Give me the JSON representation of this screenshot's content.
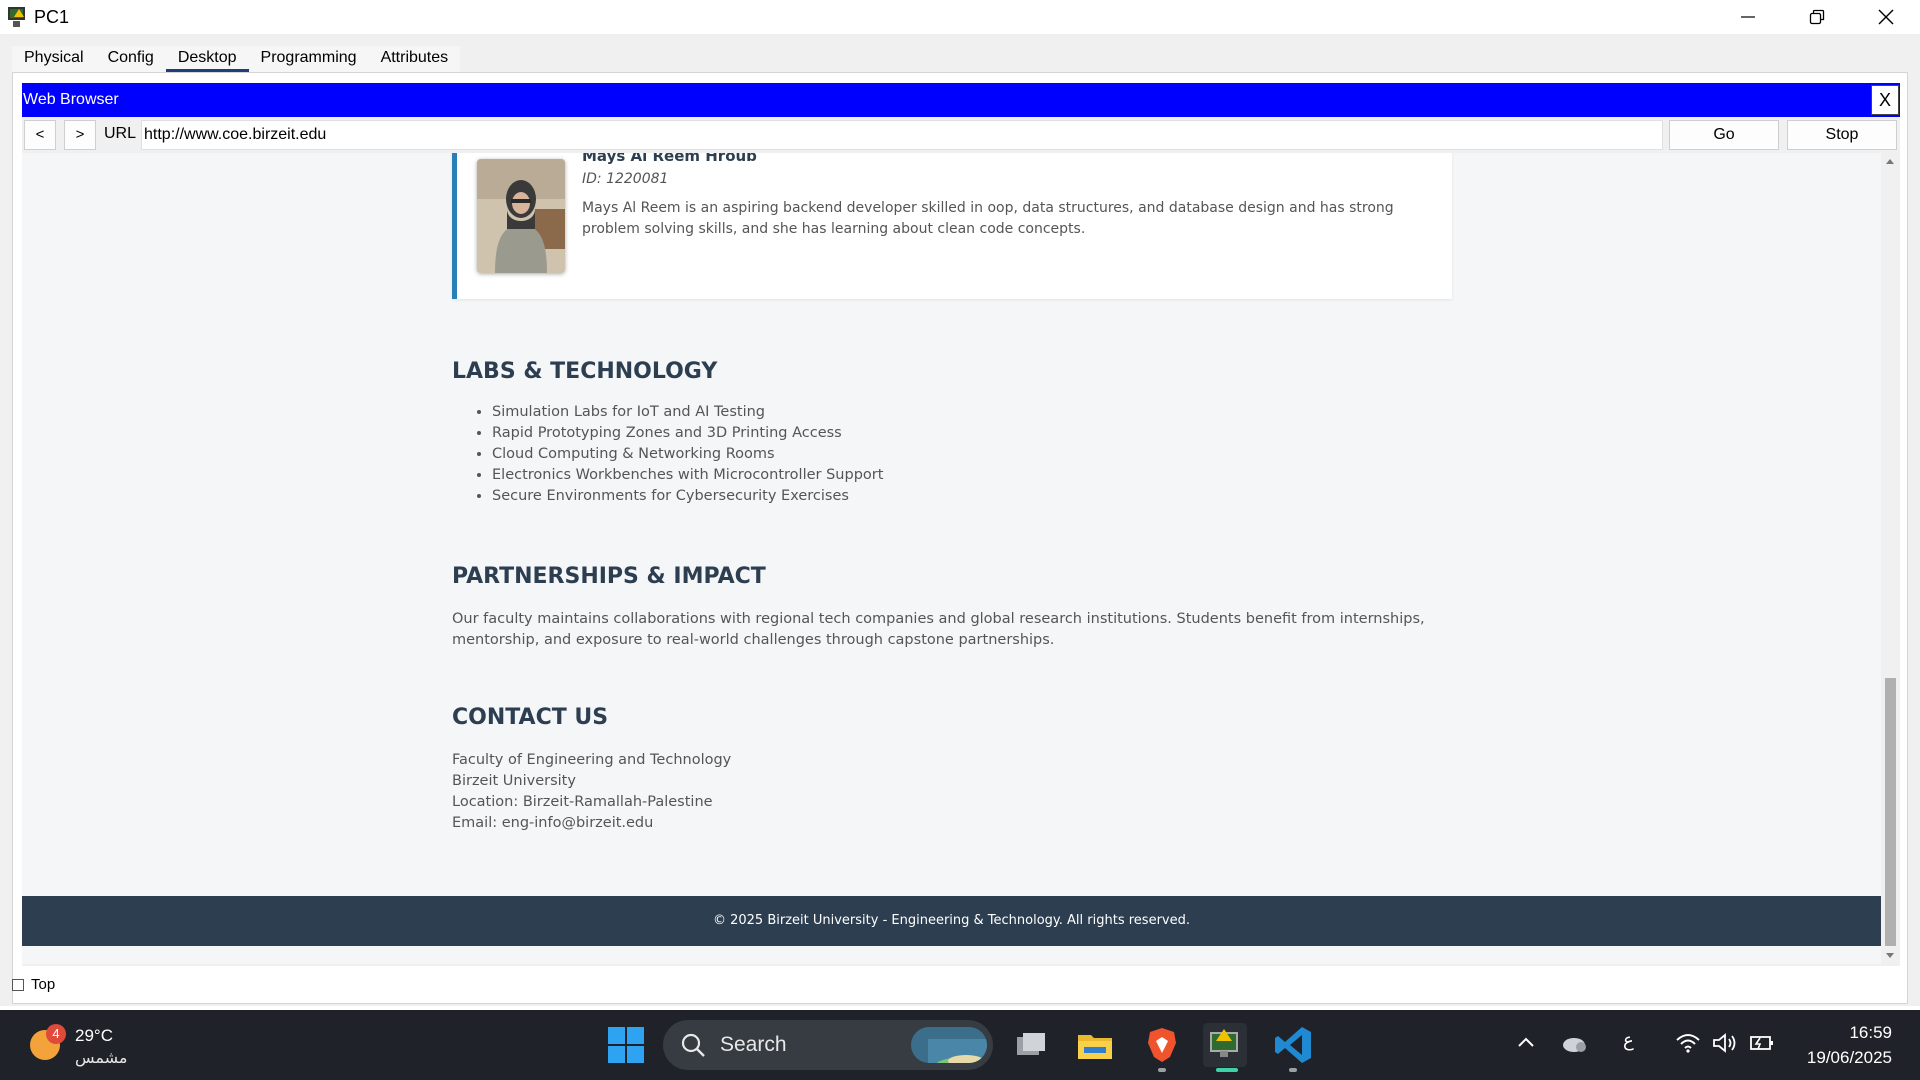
{
  "window": {
    "title": "PC1"
  },
  "tabs": [
    {
      "label": "Physical"
    },
    {
      "label": "Config"
    },
    {
      "label": "Desktop"
    },
    {
      "label": "Programming"
    },
    {
      "label": "Attributes"
    }
  ],
  "active_tab": "Desktop",
  "browser": {
    "title": "Web Browser",
    "close_label": "X",
    "back_label": "<",
    "forward_label": ">",
    "url_label": "URL",
    "url_value": "http://www.coe.birzeit.edu",
    "go_label": "Go",
    "stop_label": "Stop"
  },
  "page": {
    "member": {
      "name": "Mays Al Reem Hroub",
      "id": "ID: 1220081",
      "description": "Mays Al Reem is an aspiring backend developer skilled in oop, data structures, and database design and has strong problem solving skills, and she has learning about clean code concepts."
    },
    "labs": {
      "title": "LABS & TECHNOLOGY",
      "items": [
        "Simulation Labs for IoT and AI Testing",
        "Rapid Prototyping Zones and 3D Printing Access",
        "Cloud Computing & Networking Rooms",
        "Electronics Workbenches with Microcontroller Support",
        "Secure Environments for Cybersecurity Exercises"
      ]
    },
    "partnerships": {
      "title": "PARTNERSHIPS & IMPACT",
      "text": "Our faculty maintains collaborations with regional tech companies and global research institutions. Students benefit from internships, mentorship, and exposure to real-world challenges through capstone partnerships."
    },
    "contact": {
      "title": "CONTACT US",
      "lines": [
        "Faculty of Engineering and Technology",
        "Birzeit University",
        "Location: Birzeit-Ramallah-Palestine",
        "Email: eng-info@birzeit.edu"
      ]
    },
    "footer": "© 2025 Birzeit University - Engineering & Technology. All rights reserved."
  },
  "top_checkbox": {
    "label": "Top",
    "checked": false
  },
  "taskbar": {
    "weather": {
      "badge": "4",
      "temperature": "29°C",
      "condition": "مشمس"
    },
    "search_label": "Search",
    "language": "ع",
    "time": "16:59",
    "date": "19/06/2025"
  },
  "colors": {
    "browser_title_bar": "#0000ff",
    "card_accent": "#2980b9",
    "heading_text": "#2c3e50",
    "footer_bg": "#2c3e50",
    "active_tab_underline": "#1f3f7a"
  }
}
